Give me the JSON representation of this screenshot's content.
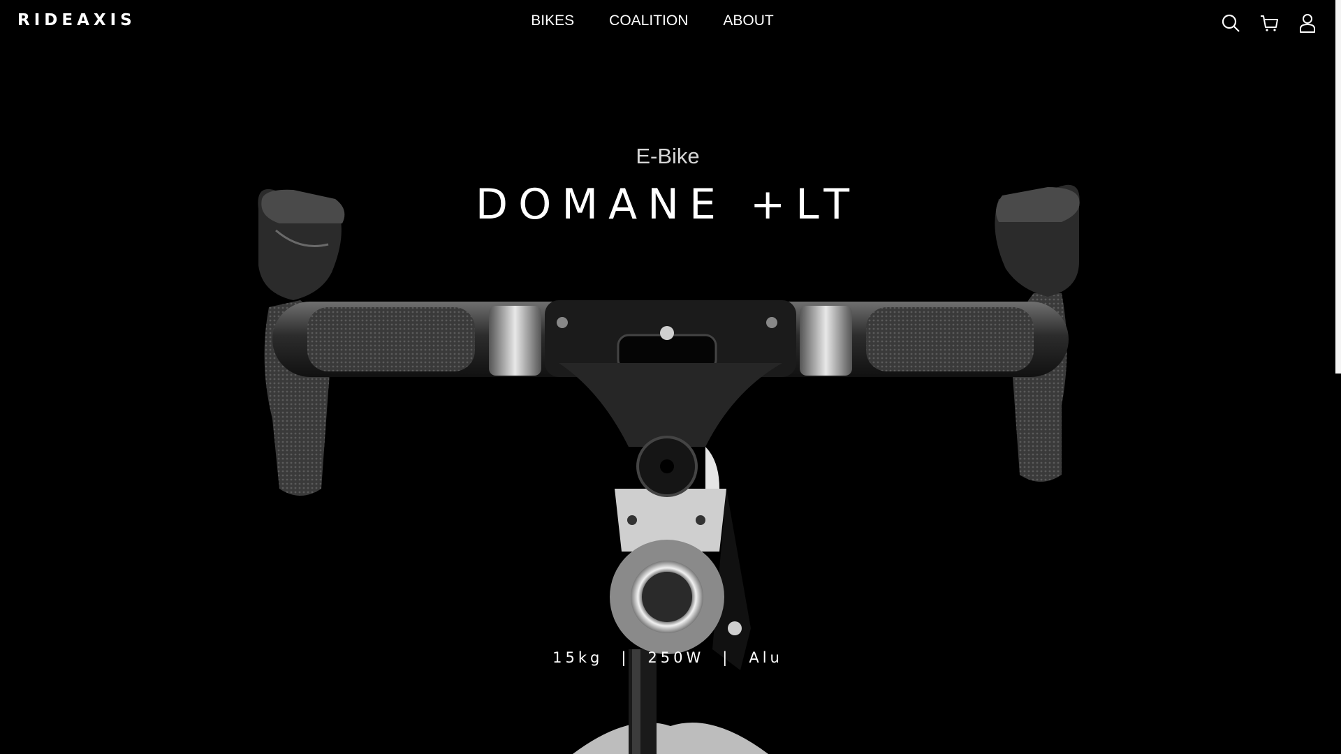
{
  "brand": {
    "logo": "RIDEAXIS"
  },
  "nav": {
    "items": [
      {
        "label": "BIKES"
      },
      {
        "label": "COALITION"
      },
      {
        "label": "ABOUT"
      }
    ]
  },
  "header_icons": [
    "search-icon",
    "cart-icon",
    "user-icon"
  ],
  "hero": {
    "subtitle": "E-Bike",
    "title": "DOMANE +LT",
    "specs": [
      {
        "value": "15kg"
      },
      {
        "value": "250W"
      },
      {
        "value": "Alu"
      }
    ],
    "separator": "|"
  },
  "colors": {
    "background": "#000000",
    "text": "#ffffff",
    "subtitle": "#d6d6d6"
  }
}
